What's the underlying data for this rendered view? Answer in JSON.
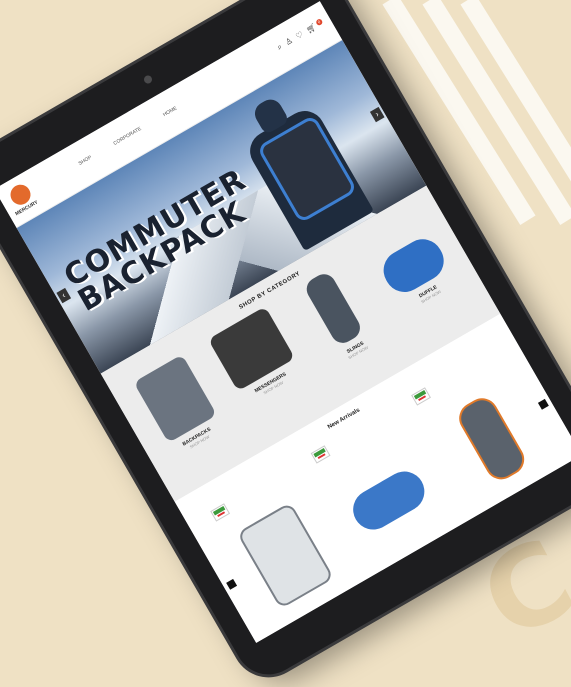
{
  "header": {
    "logo_text": "MERCURY",
    "nav": [
      "SHOP",
      "CORPORATE",
      "HOME"
    ],
    "icons": [
      "search-icon",
      "user-icon",
      "heart-icon",
      "cart-icon"
    ],
    "cart_count": "0"
  },
  "hero": {
    "title_line1": "COMMUTER",
    "title_line2": "BACKPACK"
  },
  "category": {
    "title": "SHOP BY CATEGORY",
    "items": [
      {
        "name": "BACKPACKS",
        "sub": "SHOP NOW",
        "color": "#6b7480"
      },
      {
        "name": "MESSENGERS",
        "sub": "SHOP NOW",
        "color": "#3a3a3a"
      },
      {
        "name": "SLINGS",
        "sub": "SHOP NOW",
        "color": "#4a5460"
      },
      {
        "name": "DUFFLE",
        "sub": "SHOP NOW",
        "color": "#2f6fc4"
      }
    ]
  },
  "arrivals": {
    "title": "New Arrivals",
    "products": [
      {
        "name": "white-backpack",
        "color": "#dfe3e6"
      },
      {
        "name": "blue-duffle",
        "color": "#3b78c8"
      },
      {
        "name": "grey-sling",
        "color": "#5a626c"
      }
    ]
  },
  "colors": {
    "accent": "#e36a2c",
    "background": "#efe1c4",
    "tablet": "#1d1d1f"
  }
}
